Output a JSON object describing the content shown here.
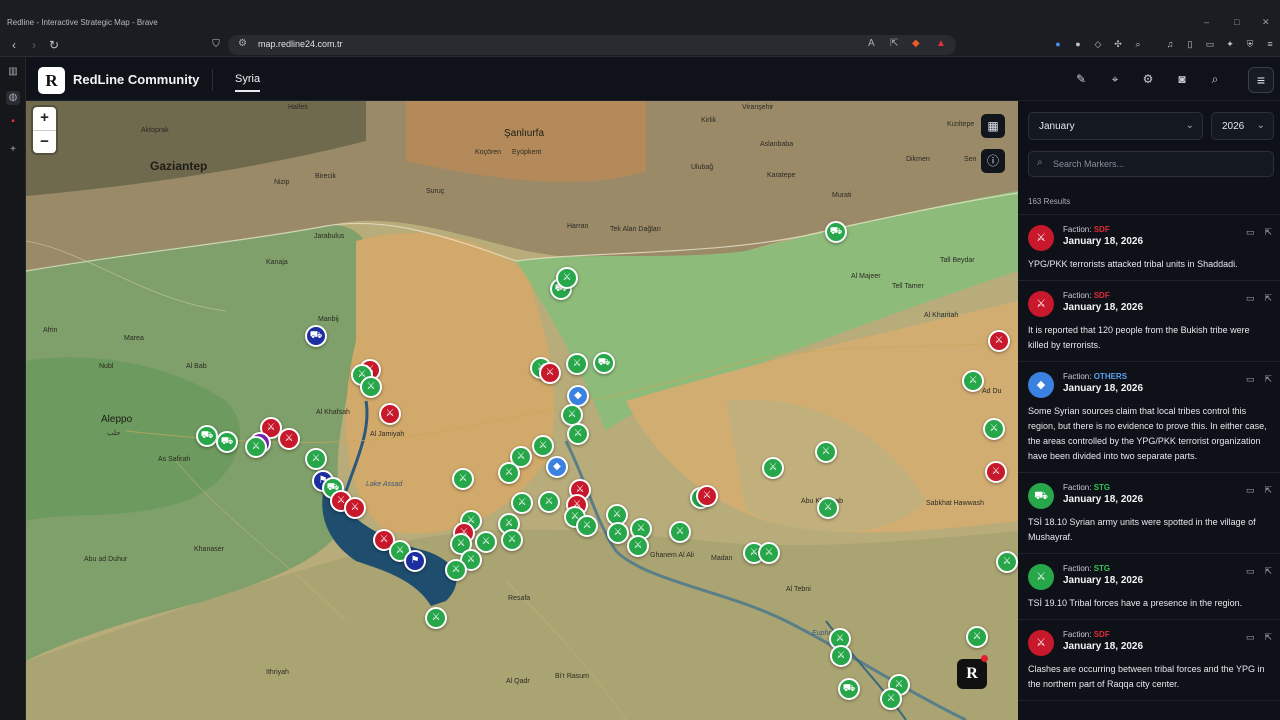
{
  "browser": {
    "window_title": "Redline - Interactive Strategic Map - Brave",
    "url": "map.redline24.com.tr"
  },
  "app": {
    "brand": "RedLine Community",
    "logo_letter": "R",
    "tab": "Syria"
  },
  "map": {
    "zoom_in": "+",
    "zoom_out": "−",
    "badge_letter": "R",
    "places": {
      "gaziantep": "Gaziantep",
      "aleppo": "Aleppo",
      "aleppo_ar": "حلب",
      "sanliurfa": "Şanlıurfa",
      "aktoprak": "Aktoprak",
      "halfeti": "Halfeti",
      "birecik": "Birecik",
      "nizip": "Nizip",
      "suruc": "Suruç",
      "jarabulus": "Jarabulus",
      "kocoren": "Koçören",
      "eyupkent": "Eyüpkent",
      "harran": "Harran",
      "akcakale": "Akçakale",
      "tekalan": "Tek Alan Dağları",
      "ceylanpinar": "Ceylanpınar",
      "viransehir": "Viranşehir",
      "kiziltepe": "Kızıltepe",
      "kirlik": "Kirlik",
      "ulubag": "Ulubağ",
      "karatepe": "Karatepe",
      "aslanbaba": "Aslanbaba",
      "murati": "Murati",
      "dikmen": "Dikmen",
      "sen": "Sen",
      "manbij": "Manbij",
      "alkhafsah": "Al Khafsah",
      "aljamiyah": "Al Jamiyah",
      "alsafirah": "As Safirah",
      "albab": "Al Bab",
      "kanaja": "Kanaja",
      "afrin": "Afrin",
      "nubl": "Nubl",
      "marea": "Marea",
      "lake_assad": "Lake Assad",
      "alkahmah": "Al Kahmah",
      "khanaser": "Khanaser",
      "abualdhuhur": "Abu ad Duhur",
      "ithriyah": "Ithriyah",
      "resafa": "Resafa",
      "ghanem": "Ghanem Al Ali",
      "madan": "Madan",
      "abukhashab": "Abu Khashab",
      "sabkhat": "Sabkhat Hawwash",
      "altebni": "Al Tebni",
      "euphrates": "Euphrates",
      "alqadr": "Al Qadr",
      "birrasum": "Bi'r Rasum",
      "telltamer": "Tell Tamer",
      "tellbeydar": "Tall Beydar",
      "almajeer": "Al Majeer",
      "alkharitah": "Al Kharitah",
      "addu": "Ad Du",
      "sahl": "Sahl",
      "tallabyad": "Tall Abyad",
      "aryma": "Arima",
      "alhusain": "Al Husain",
      "ayn": "Ayn",
      "ash": "As Sur",
      "alkharam": "Al Kharam"
    }
  },
  "panel": {
    "month": "January",
    "year": "2026",
    "search_placeholder": "Search Markers...",
    "results": "163 Results",
    "faction_label": "Faction:",
    "items": [
      {
        "faction": "SDF",
        "faction_color": "#e02a3a",
        "date": "January 18, 2026",
        "text": "YPG/PKK terrorists attacked tribal units in Shaddadi.",
        "icon": "rifle-icon",
        "tone": "r"
      },
      {
        "faction": "SDF",
        "faction_color": "#e02a3a",
        "date": "January 18, 2026",
        "text": "It is reported that 120 people from the Bukish tribe were killed by terrorists.",
        "icon": "rifle-icon",
        "tone": "r"
      },
      {
        "faction": "OTHERS",
        "faction_color": "#5aa0f0",
        "date": "January 18, 2026",
        "text": "Some Syrian sources claim that local tribes control this region, but there is no evidence to prove this. In either case, the areas controlled by the YPG/PKK terrorist organization have been divided into two separate parts.",
        "icon": "megaphone-icon",
        "tone": "b"
      },
      {
        "faction": "STG",
        "faction_color": "#34c45a",
        "date": "January 18, 2026",
        "text": "TSİ 18.10 Syrian army units were spotted in the village of Mushayraf.",
        "icon": "truck-icon",
        "tone": "g"
      },
      {
        "faction": "STG",
        "faction_color": "#34c45a",
        "date": "January 18, 2026",
        "text": "TSİ 19.10 Tribal forces have a presence in the region.",
        "icon": "rifle-icon",
        "tone": "g"
      },
      {
        "faction": "SDF",
        "faction_color": "#e02a3a",
        "date": "January 18, 2026",
        "text": "Clashes are occurring between tribal forces and the YPG in the northern part of Raqqa city center.",
        "icon": "rifle-icon",
        "tone": "r"
      }
    ]
  },
  "colors": {
    "sdf": "#c8182b",
    "stg": "#27a74a",
    "others": "#3b82e0"
  }
}
